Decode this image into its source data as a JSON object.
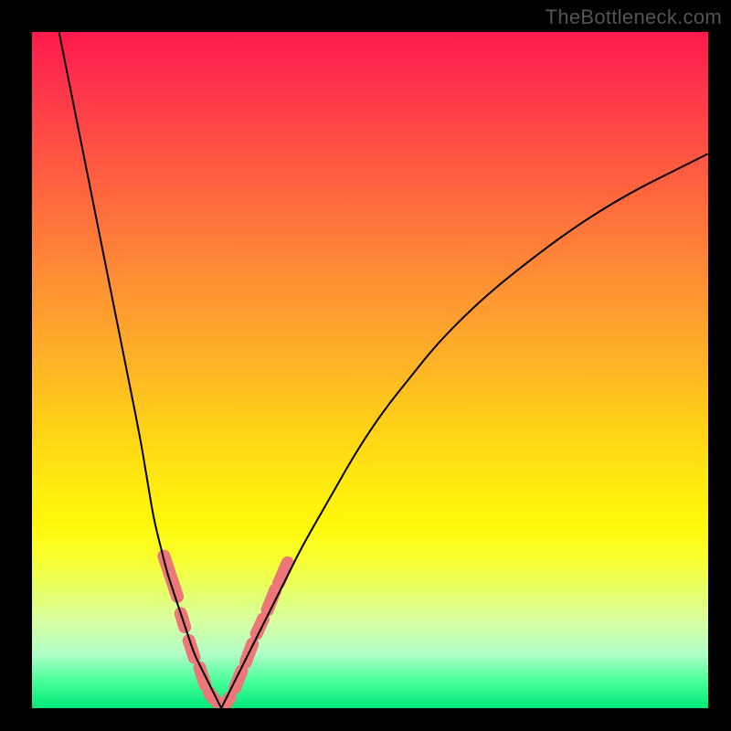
{
  "watermark": "TheBottleneck.com",
  "chart_data": {
    "type": "line",
    "title": "",
    "xlabel": "",
    "ylabel": "",
    "xlim": [
      0,
      100
    ],
    "ylim": [
      0,
      100
    ],
    "grid": false,
    "legend": false,
    "background_gradient": {
      "direction": "vertical",
      "stops": [
        {
          "pos": 0.0,
          "color": "#ff1a4d"
        },
        {
          "pos": 0.5,
          "color": "#ffc020"
        },
        {
          "pos": 0.78,
          "color": "#f8ff30"
        },
        {
          "pos": 1.0,
          "color": "#00e878"
        }
      ]
    },
    "series": [
      {
        "name": "left-curve",
        "color": "#000000",
        "width": 2,
        "x": [
          4,
          6,
          8,
          10,
          12,
          14,
          16,
          17,
          18,
          19,
          20,
          21,
          22,
          23,
          24,
          25,
          26,
          27,
          28
        ],
        "y": [
          100,
          90,
          80,
          70,
          60,
          50,
          40,
          34,
          28,
          24,
          20,
          17,
          14,
          11,
          8,
          6,
          4,
          2,
          0
        ]
      },
      {
        "name": "right-curve",
        "color": "#000000",
        "width": 2,
        "x": [
          28,
          30,
          32,
          34,
          36,
          38,
          40,
          44,
          48,
          52,
          56,
          60,
          66,
          72,
          80,
          88,
          96,
          100
        ],
        "y": [
          0,
          4,
          8,
          12,
          16,
          20,
          24,
          31,
          38,
          44,
          49,
          54,
          60,
          65,
          71,
          76,
          80,
          82
        ]
      }
    ],
    "markers": {
      "name": "thick-segments",
      "color": "#ec7678",
      "stroke_width": 14,
      "linecap": "round",
      "segments_left": [
        {
          "x0": 19.5,
          "y0": 22.5,
          "x1": 21.5,
          "y1": 16.5
        },
        {
          "x0": 22.0,
          "y0": 14.0,
          "x1": 22.6,
          "y1": 12.0
        },
        {
          "x0": 23.2,
          "y0": 10.0,
          "x1": 24.0,
          "y1": 7.5
        },
        {
          "x0": 24.8,
          "y0": 6.0,
          "x1": 25.6,
          "y1": 3.5
        },
        {
          "x0": 26.2,
          "y0": 2.3,
          "x1": 27.0,
          "y1": 1.3
        },
        {
          "x0": 27.5,
          "y0": 0.8,
          "x1": 28.0,
          "y1": 0.4
        }
      ],
      "segments_right": [
        {
          "x0": 28.5,
          "y0": 0.5,
          "x1": 29.3,
          "y1": 1.6
        },
        {
          "x0": 30.0,
          "y0": 3.0,
          "x1": 31.0,
          "y1": 5.5
        },
        {
          "x0": 31.6,
          "y0": 6.8,
          "x1": 32.6,
          "y1": 9.5
        },
        {
          "x0": 33.2,
          "y0": 11.0,
          "x1": 34.2,
          "y1": 13.2
        },
        {
          "x0": 34.8,
          "y0": 14.5,
          "x1": 36.0,
          "y1": 17.5
        },
        {
          "x0": 36.5,
          "y0": 18.5,
          "x1": 37.8,
          "y1": 21.5
        }
      ]
    }
  }
}
